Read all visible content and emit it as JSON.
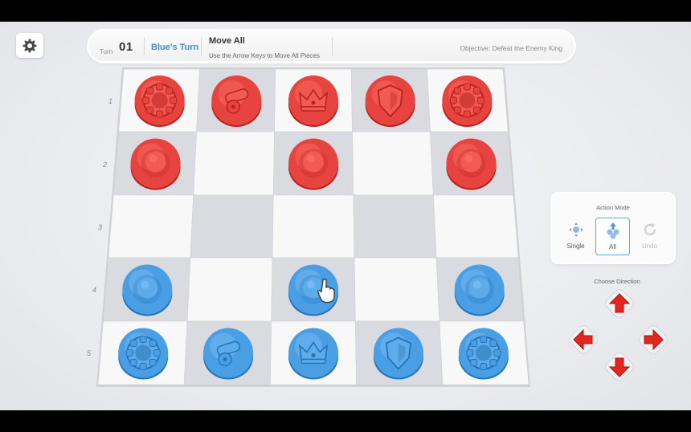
{
  "topbar": {
    "turn_label": "Turn",
    "turn_number": "01",
    "player_turn": "Blue's Turn",
    "mode_title": "Move All",
    "mode_hint": "Use the Arrow Keys to Move All Pieces",
    "objective": "Objective: Defeat the Enemy King"
  },
  "board": {
    "rows": [
      "1",
      "2",
      "3",
      "4",
      "5"
    ],
    "pieces": [
      {
        "row": 1,
        "col": 1,
        "team": "red",
        "type": "tower"
      },
      {
        "row": 1,
        "col": 2,
        "team": "red",
        "type": "cannon"
      },
      {
        "row": 1,
        "col": 3,
        "team": "red",
        "type": "king"
      },
      {
        "row": 1,
        "col": 4,
        "team": "red",
        "type": "shield"
      },
      {
        "row": 1,
        "col": 5,
        "team": "red",
        "type": "tower"
      },
      {
        "row": 2,
        "col": 1,
        "team": "red",
        "type": "pawn"
      },
      {
        "row": 2,
        "col": 3,
        "team": "red",
        "type": "pawn"
      },
      {
        "row": 2,
        "col": 5,
        "team": "red",
        "type": "pawn"
      },
      {
        "row": 4,
        "col": 1,
        "team": "blue",
        "type": "pawn"
      },
      {
        "row": 4,
        "col": 3,
        "team": "blue",
        "type": "pawn"
      },
      {
        "row": 4,
        "col": 5,
        "team": "blue",
        "type": "pawn"
      },
      {
        "row": 5,
        "col": 1,
        "team": "blue",
        "type": "tower"
      },
      {
        "row": 5,
        "col": 2,
        "team": "blue",
        "type": "cannon"
      },
      {
        "row": 5,
        "col": 3,
        "team": "blue",
        "type": "king"
      },
      {
        "row": 5,
        "col": 4,
        "team": "blue",
        "type": "shield"
      },
      {
        "row": 5,
        "col": 5,
        "team": "blue",
        "type": "tower"
      }
    ],
    "cursor": {
      "row": 4,
      "col": 3,
      "icon": "hand-pointer-icon"
    }
  },
  "action_panel": {
    "title": "Action Mode",
    "buttons": [
      {
        "label": "Single",
        "icon": "single-move-icon",
        "state": "normal"
      },
      {
        "label": "All",
        "icon": "all-move-icon",
        "state": "active"
      },
      {
        "label": "Undo",
        "icon": "undo-icon",
        "state": "disabled"
      }
    ]
  },
  "direction": {
    "title": "Choose Direction",
    "buttons": [
      "up",
      "left",
      "right",
      "down"
    ]
  },
  "colors": {
    "red": "#e8443f",
    "blue": "#4a9fe4",
    "accent": "#3c8fd4",
    "arrow": "#e3271f"
  }
}
